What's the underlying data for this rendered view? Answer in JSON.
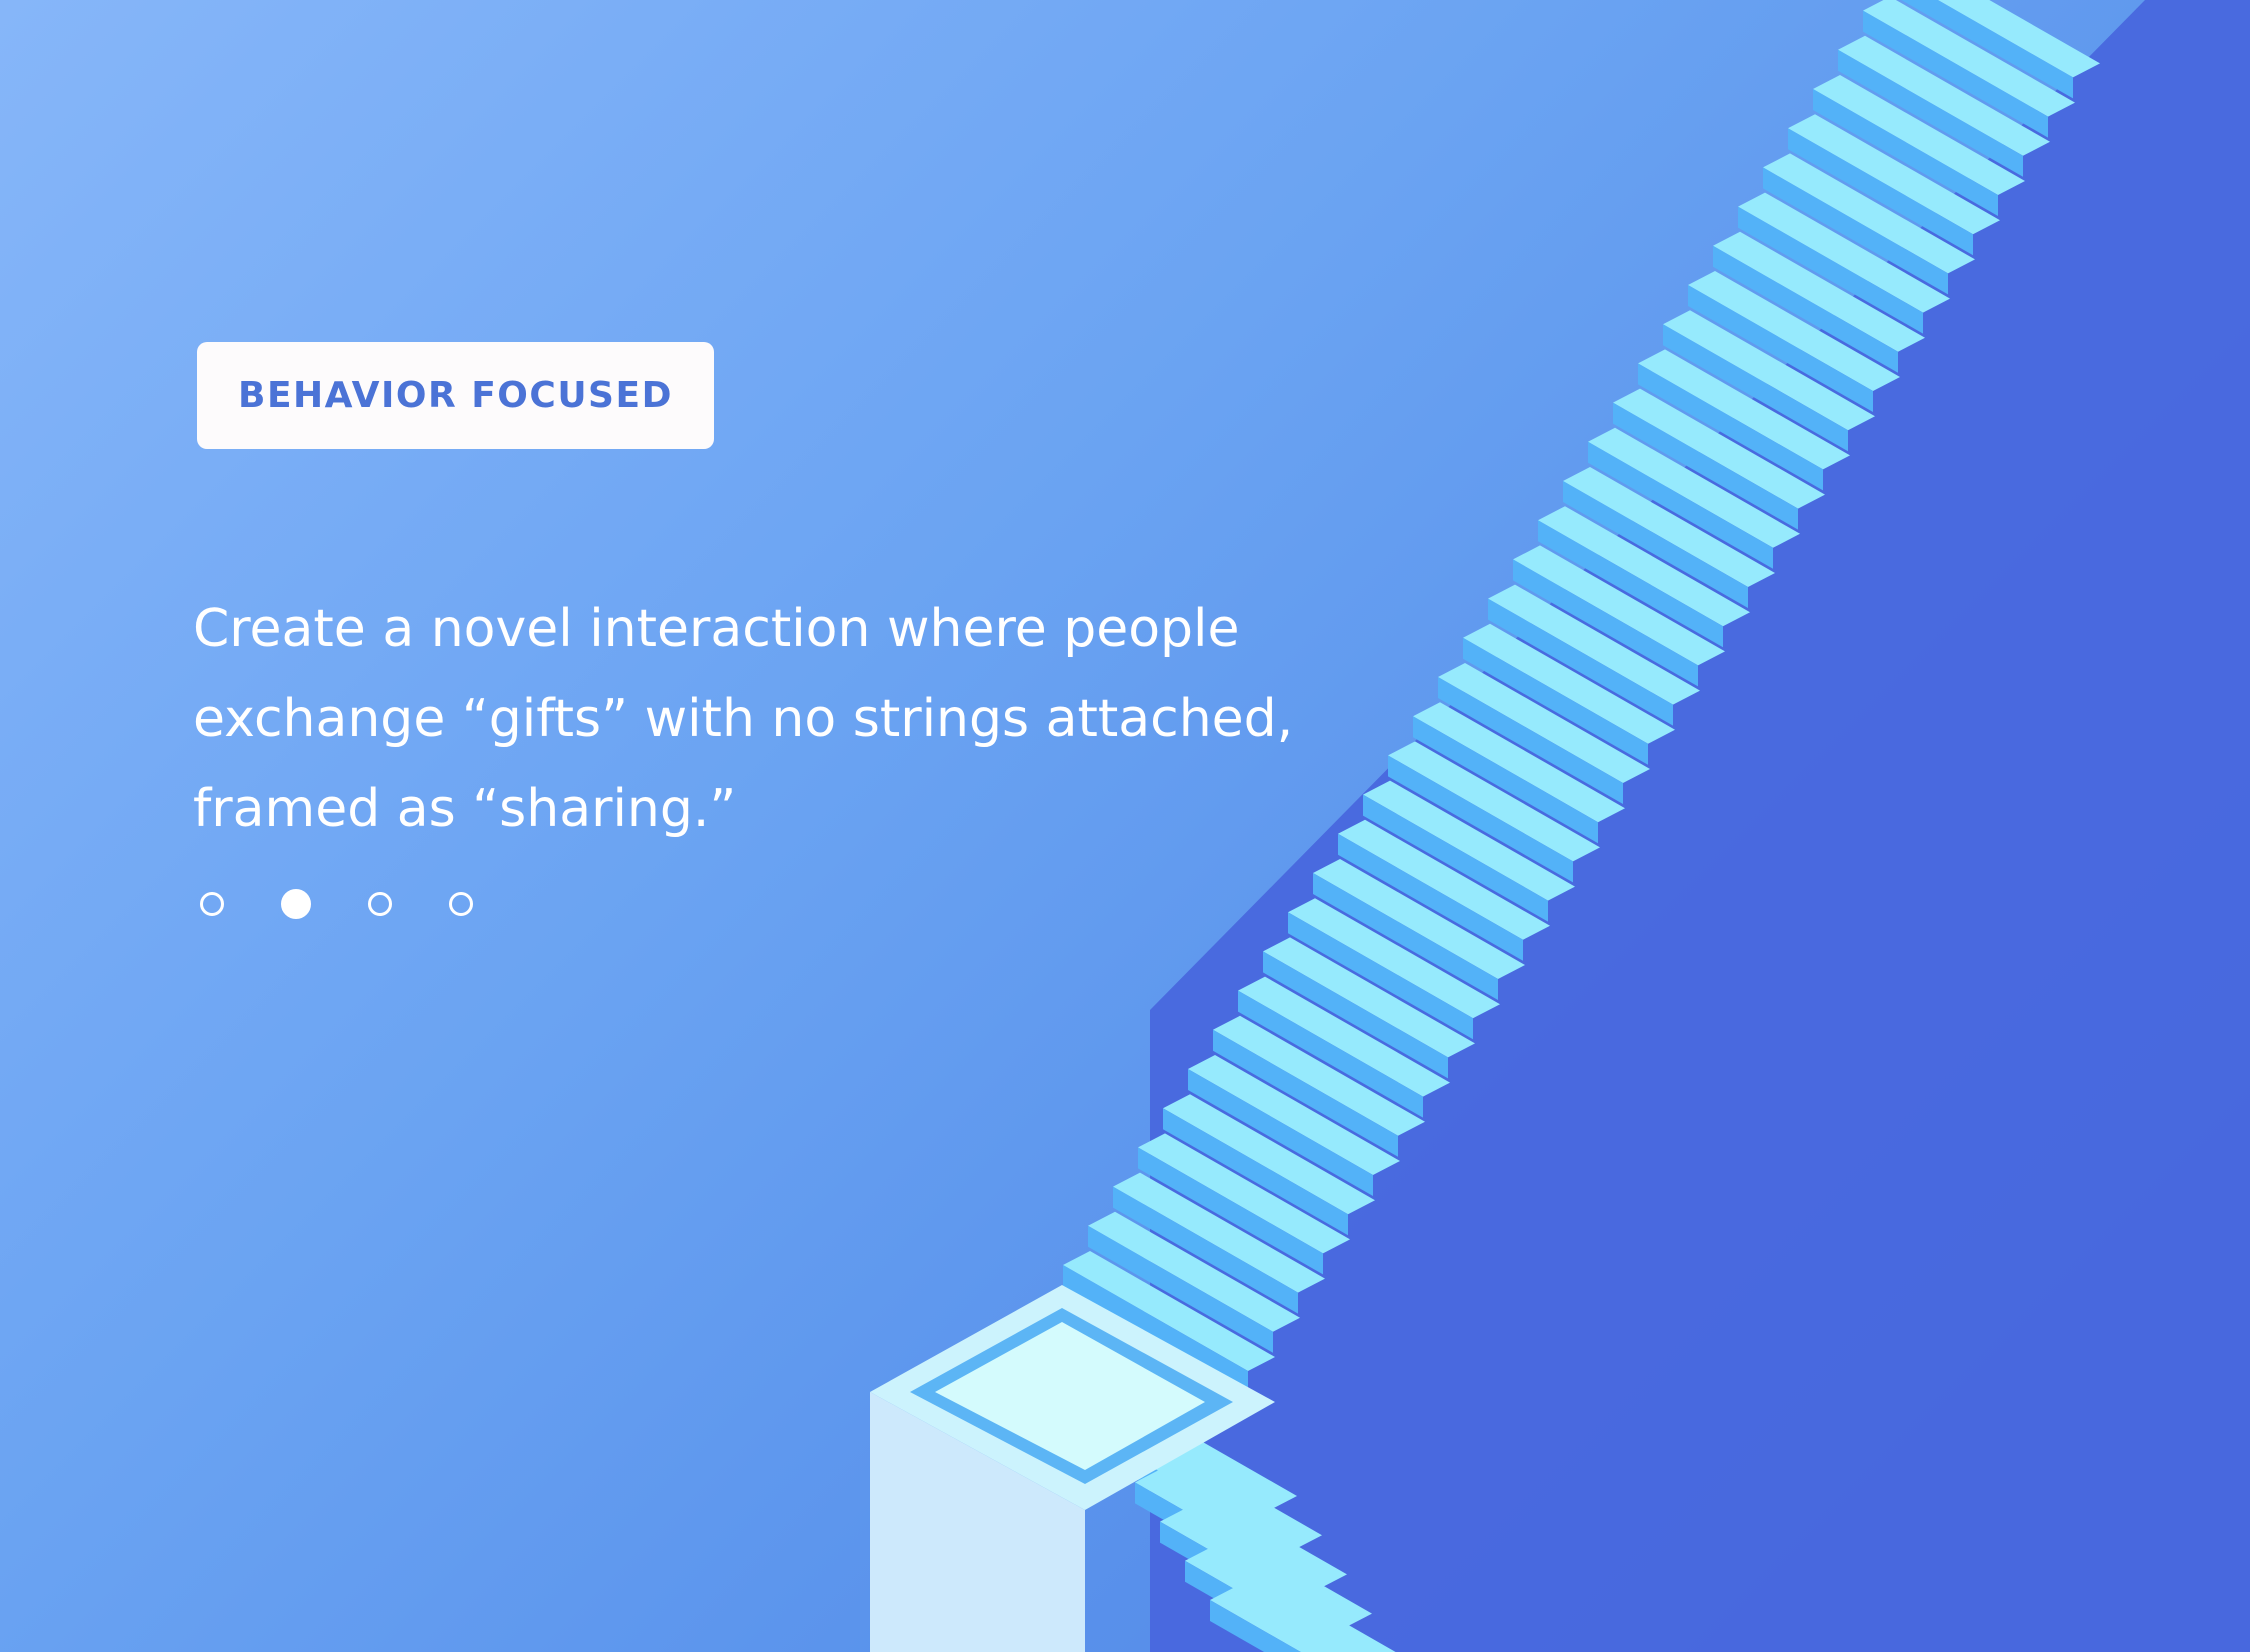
{
  "tag_label": "BEHAVIOR FOCUSED",
  "headline": {
    "line1": "Create a novel interaction where people",
    "line2": "exchange “gifts” with no strings attached,",
    "line3": "framed as “sharing.”"
  },
  "pagination": {
    "total": 4,
    "active_index": 1
  },
  "colors": {
    "right_panel": "#4866dd",
    "step_top": "#96eafd",
    "step_riser": "#53b2f8",
    "platform_top": "#ccf3fd",
    "platform_front": "#cde9fc",
    "tag_text": "#4b73d6"
  }
}
